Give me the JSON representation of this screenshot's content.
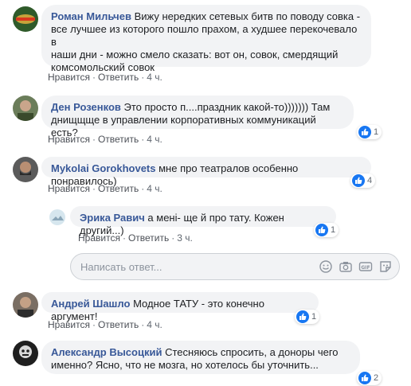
{
  "comments": [
    {
      "author": "Роман Мильчев",
      "lines": [
        "Вижу нередких сетевых битв по поводу совка -",
        "все лучшее из которого пошло прахом, а худшее перекочевало в",
        "наши дни - можно смело сказать: вот он, совок, смердящий",
        "комсомольский совок"
      ],
      "like": "Нравится",
      "reply": "Ответить",
      "time": "4 ч.",
      "reactions": ""
    },
    {
      "author": "Ден Розенков",
      "lines": [
        "Это просто п....праздник какой-то))))))) Там",
        "днищщще в управлении корпоративных коммуникаций есть?"
      ],
      "like": "Нравится",
      "reply": "Ответить",
      "time": "4 ч.",
      "reactions": "1"
    },
    {
      "author": "Mykolai Gorokhovets",
      "lines": [
        "мне про театралов особенно понравилось)"
      ],
      "like": "Нравится",
      "reply": "Ответить",
      "time": "4 ч.",
      "reactions": "4"
    },
    {
      "author": "Эрика Равич",
      "lines": [
        "а мені- ще й про тату. Кожен другий...)"
      ],
      "like": "Нравится",
      "reply": "Ответить",
      "time": "3 ч.",
      "reactions": "1"
    },
    {
      "author": "Андрей Шашло",
      "lines": [
        "Модное ТАТУ - это конечно аргумент!"
      ],
      "like": "Нравится",
      "reply": "Ответить",
      "time": "4 ч.",
      "reactions": "1"
    },
    {
      "author": "Александр Высоцкий",
      "lines": [
        "Стесняюсь спросить, а доноры чего",
        "именно? Ясно, что не мозга, но хотелось бы уточнить..."
      ],
      "like": "Нравится",
      "reply": "Ответить",
      "time": "4 ч.",
      "reactions": "2"
    }
  ],
  "reply_input": {
    "placeholder": "Написать ответ..."
  },
  "icons": [
    "emoji-icon",
    "camera-icon",
    "gif-icon",
    "sticker-icon"
  ],
  "colors": {
    "author": "#385898",
    "bubble": "#f2f3f5",
    "like_blue": "#1877f2"
  }
}
